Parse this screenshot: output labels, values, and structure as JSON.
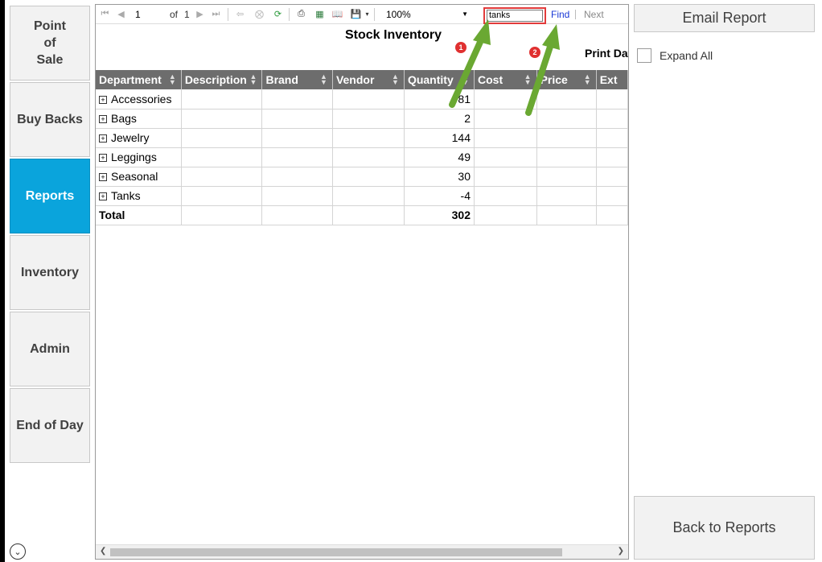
{
  "nav": {
    "items": [
      {
        "label": "Point\nof\nSale",
        "active": false
      },
      {
        "label": "Buy Backs",
        "active": false
      },
      {
        "label": "Reports",
        "active": true
      },
      {
        "label": "Inventory",
        "active": false
      },
      {
        "label": "Admin",
        "active": false
      },
      {
        "label": "End of Day",
        "active": false
      }
    ]
  },
  "toolbar": {
    "page_value": "1",
    "of_label": "of",
    "total_pages": "1",
    "zoom": "100%",
    "find_text": "tanks",
    "find_label": "Find",
    "separator": "|",
    "next_label": "Next"
  },
  "report": {
    "title": "Stock Inventory",
    "print_date_label": "Print Dat",
    "columns": [
      "Department",
      "Description",
      "Brand",
      "Vendor",
      "Quantity",
      "Cost",
      "Price",
      "Ext"
    ],
    "rows": [
      {
        "department": "Accessories",
        "quantity": "81"
      },
      {
        "department": "Bags",
        "quantity": "2"
      },
      {
        "department": "Jewelry",
        "quantity": "144"
      },
      {
        "department": "Leggings",
        "quantity": "49"
      },
      {
        "department": "Seasonal",
        "quantity": "30"
      },
      {
        "department": "Tanks",
        "quantity": "-4"
      }
    ],
    "total_label": "Total",
    "total_quantity": "302"
  },
  "annotations": {
    "marker_1": "1",
    "marker_2": "2",
    "arrow_color": "#6aa832",
    "marker_color": "#e03030"
  },
  "right": {
    "email_label": "Email Report",
    "expand_all_label": "Expand All",
    "back_label": "Back to Reports"
  },
  "colors": {
    "accent": "#0aa4dc",
    "header_bg": "#6d6d6d",
    "highlight_border": "#e23b3b"
  }
}
